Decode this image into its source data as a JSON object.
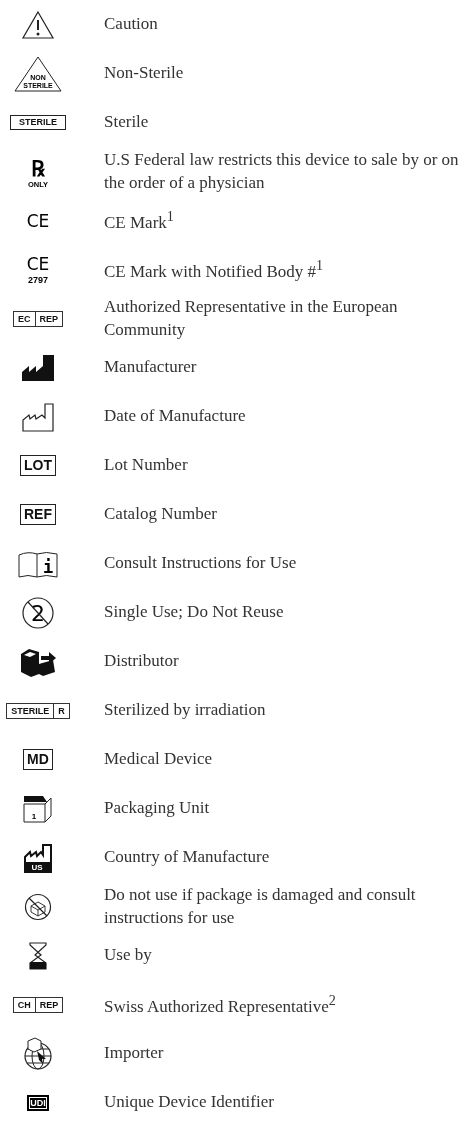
{
  "symbols": [
    {
      "kind": "caution",
      "label": "Caution"
    },
    {
      "kind": "triangle-text",
      "icon_text": [
        "NON",
        "STERILE"
      ],
      "label": "Non-Sterile"
    },
    {
      "kind": "boxed",
      "icon_text": [
        "STERILE"
      ],
      "label": "Sterile"
    },
    {
      "kind": "rx",
      "icon_text": [
        "℞",
        "ONLY"
      ],
      "label": "U.S Federal law restricts this device to sale by or on the order of a physician"
    },
    {
      "kind": "ce",
      "icon_text": [
        "CE"
      ],
      "label": "CE Mark$^{1}$"
    },
    {
      "kind": "ce",
      "icon_text": [
        "CE",
        "2797"
      ],
      "label": "CE Mark with Notified Body #$^{1}$"
    },
    {
      "kind": "split-box",
      "icon_text": [
        "EC",
        "REP"
      ],
      "label": "Authorized Representative in the European Community"
    },
    {
      "kind": "factory-filled",
      "label": "Manufacturer"
    },
    {
      "kind": "factory-outline",
      "label": "Date of Manufacture"
    },
    {
      "kind": "boxed",
      "icon_text": [
        "LOT"
      ],
      "label": "Lot Number"
    },
    {
      "kind": "boxed",
      "icon_text": [
        "REF"
      ],
      "label": "Catalog Number"
    },
    {
      "kind": "book",
      "icon_text": [
        "i"
      ],
      "label": "Consult Instructions for Use"
    },
    {
      "kind": "no-reuse",
      "icon_text": [
        "2"
      ],
      "label": "Single Use; Do Not Reuse"
    },
    {
      "kind": "distributor",
      "label": "Distributor"
    },
    {
      "kind": "split-box",
      "icon_text": [
        "STERILE",
        "R"
      ],
      "label": "Sterilized by irradiation"
    },
    {
      "kind": "boxed",
      "icon_text": [
        "MD"
      ],
      "label": "Medical Device"
    },
    {
      "kind": "package",
      "icon_text": [
        "1"
      ],
      "label": "Packaging Unit"
    },
    {
      "kind": "factory-country",
      "icon_text": [
        "US"
      ],
      "label": "Country of Manufacture"
    },
    {
      "kind": "damaged",
      "label": "Do not use if package is damaged and consult instructions for use"
    },
    {
      "kind": "hourglass",
      "label": "Use by"
    },
    {
      "kind": "split-box",
      "icon_text": [
        "CH",
        "REP"
      ],
      "label": "Swiss Authorized Representative$^{2}$"
    },
    {
      "kind": "importer",
      "label": "Importer"
    },
    {
      "kind": "inverse-box",
      "icon_text": [
        "UDI"
      ],
      "label": "Unique Device Identifier"
    }
  ]
}
